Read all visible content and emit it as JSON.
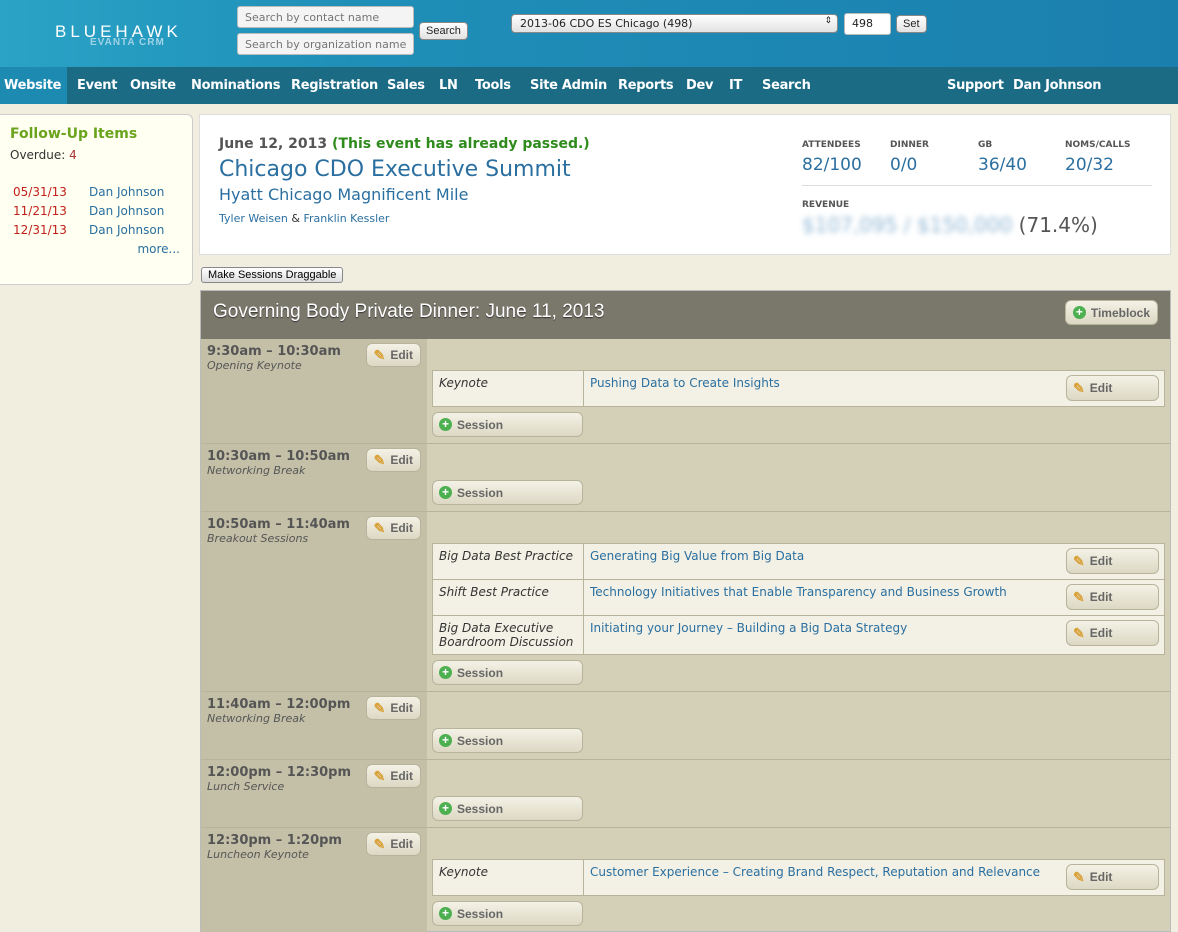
{
  "brand": {
    "name": "BLUEHAWK",
    "sub": "EVANTA CRM"
  },
  "search": {
    "contact_placeholder": "Search by contact name",
    "org_placeholder": "Search by organization name",
    "button": "Search"
  },
  "event_select": {
    "value": "2013-06 CDO ES Chicago (498)",
    "id_value": "498",
    "set_label": "Set"
  },
  "nav": [
    "Website",
    "Event",
    "Onsite",
    "Nominations",
    "Registration",
    "Sales",
    "LN",
    "Tools",
    "Site Admin",
    "Reports",
    "Dev",
    "IT",
    "Search"
  ],
  "nav_right": [
    "Support",
    "Dan Johnson"
  ],
  "followup": {
    "title": "Follow-Up Items",
    "overdue_label": "Overdue:",
    "overdue_count": "4",
    "items": [
      {
        "date": "05/31/13",
        "name": "Dan Johnson"
      },
      {
        "date": "11/21/13",
        "name": "Dan Johnson"
      },
      {
        "date": "12/31/13",
        "name": "Dan Johnson"
      }
    ],
    "more": "more..."
  },
  "event": {
    "date": "June 12, 2013",
    "passed": "(This event has already passed.)",
    "title": "Chicago CDO Executive Summit",
    "venue": "Hyatt Chicago Magnificent Mile",
    "person1": "Tyler Weisen",
    "amp": "&",
    "person2": "Franklin Kessler"
  },
  "stats": [
    {
      "label": "ATTENDEES",
      "value": "82/100"
    },
    {
      "label": "DINNER",
      "value": "0/0"
    },
    {
      "label": "GB",
      "value": "36/40"
    },
    {
      "label": "NOMS/CALLS",
      "value": "20/32"
    }
  ],
  "revenue": {
    "label": "REVENUE",
    "value": "$107,095 / $150,000",
    "pct": "(71.4%)"
  },
  "drag_button": "Make Sessions Draggable",
  "main": {
    "title": "Governing Body Private Dinner: June 11, 2013",
    "timeblock_btn": "Timeblock",
    "edit": "Edit",
    "session_btn": "Session",
    "timeblocks": [
      {
        "time": "9:30am – 10:30am",
        "name": "Opening Keynote",
        "sessions": [
          {
            "type": "Keynote",
            "title": "Pushing Data to Create Insights"
          }
        ]
      },
      {
        "time": "10:30am – 10:50am",
        "name": "Networking Break",
        "sessions": []
      },
      {
        "time": "10:50am – 11:40am",
        "name": "Breakout Sessions",
        "sessions": [
          {
            "type": "Big Data Best Practice",
            "title": "Generating Big Value from Big Data"
          },
          {
            "type": "Shift Best Practice",
            "title": "Technology Initiatives that Enable Transparency and Business Growth"
          },
          {
            "type": "Big Data Executive Boardroom Discussion",
            "title": "Initiating your Journey – Building a Big Data Strategy"
          }
        ]
      },
      {
        "time": "11:40am – 12:00pm",
        "name": "Networking Break",
        "sessions": []
      },
      {
        "time": "12:00pm – 12:30pm",
        "name": "Lunch Service",
        "sessions": []
      },
      {
        "time": "12:30pm – 1:20pm",
        "name": "Luncheon Keynote",
        "sessions": [
          {
            "type": "Keynote",
            "title": "Customer Experience – Creating Brand Respect, Reputation and Relevance"
          }
        ]
      }
    ]
  }
}
